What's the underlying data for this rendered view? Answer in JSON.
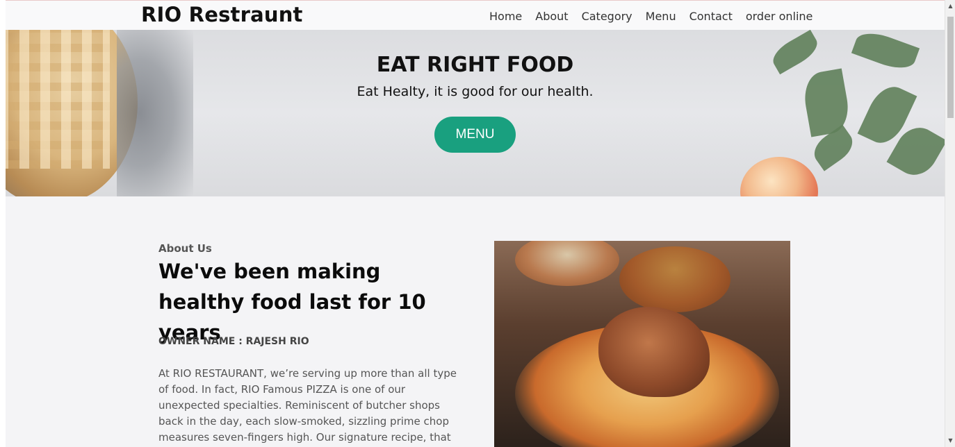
{
  "header": {
    "brand": "RIO Restraunt",
    "nav": [
      "Home",
      "About",
      "Category",
      "Menu",
      "Contact",
      "order online"
    ]
  },
  "hero": {
    "title": "EAT RIGHT FOOD",
    "subtitle": "Eat Healty, it is good for our health.",
    "button_label": "MENU"
  },
  "about": {
    "kicker": "About Us",
    "title": "We've been making healthy food last for 10 years",
    "owner": "OWNER NAME : RAJESH RIO",
    "text": "At RIO RESTAURANT, we’re serving up more than all type of food. In fact, RIO Famous PIZZA is one of our unexpected specialties. Reminiscent of butcher shops back in the day, each slow-smoked, sizzling prime chop measures seven-fingers high. Our signature recipe, that"
  },
  "colors": {
    "accent": "#19a07f",
    "page_bg": "#f4f4f6"
  },
  "scrollbar": {
    "up_icon": "triangle-up-icon",
    "down_icon": "triangle-down-icon"
  }
}
